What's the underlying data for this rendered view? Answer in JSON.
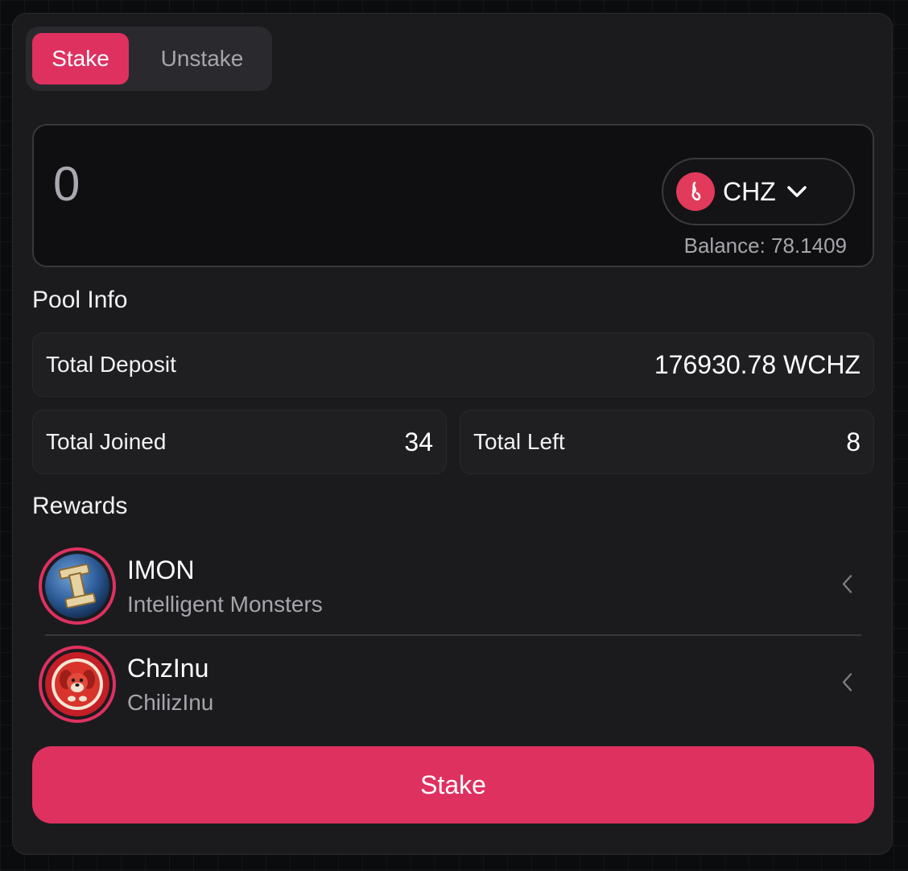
{
  "tabs": {
    "stake_label": "Stake",
    "unstake_label": "Unstake",
    "active": "Stake"
  },
  "amount": {
    "value": "0",
    "token": "CHZ",
    "token_icon": "chiliz-flame-icon",
    "balance_label": "Balance: 78.1409"
  },
  "pool_info": {
    "title": "Pool Info",
    "total_deposit_label": "Total Deposit",
    "total_deposit_value": "176930.78 WCHZ",
    "total_joined_label": "Total Joined",
    "total_joined_value": "34",
    "total_left_label": "Total Left",
    "total_left_value": "8"
  },
  "rewards": {
    "title": "Rewards",
    "items": [
      {
        "symbol": "IMON",
        "name": "Intelligent Monsters",
        "icon": "imon-logo-icon"
      },
      {
        "symbol": "ChzInu",
        "name": "ChilizInu",
        "icon": "chzinu-dog-icon"
      }
    ]
  },
  "actions": {
    "stake_button": "Stake"
  },
  "colors": {
    "accent": "#de3160",
    "card": "#1b1b1e",
    "page": "#0b0c0e"
  }
}
